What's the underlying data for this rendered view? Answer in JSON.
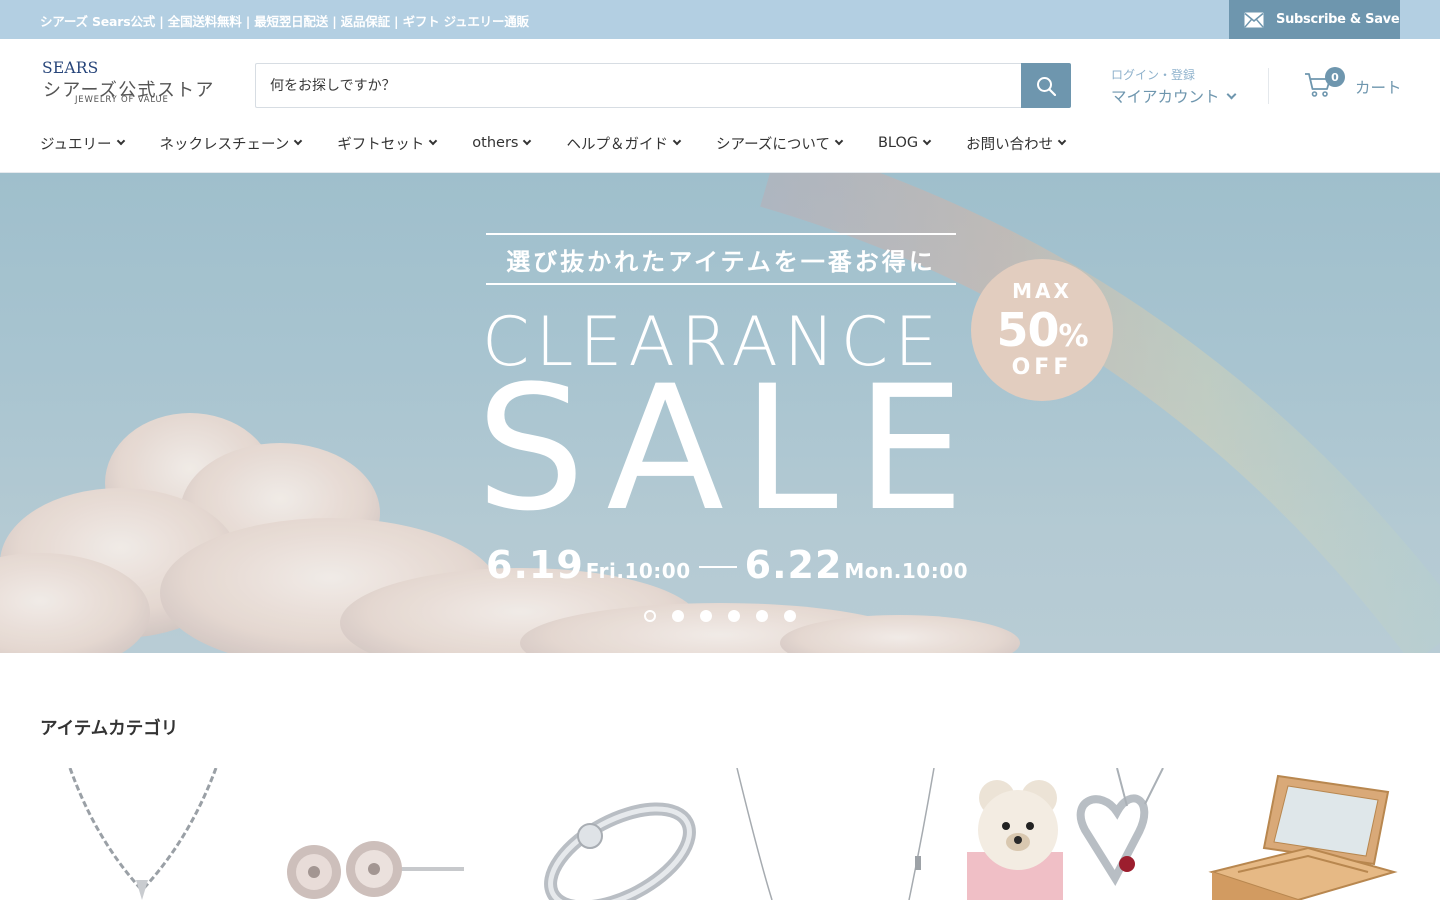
{
  "announcement": {
    "text": "シアーズ Sears公式 | 全国送料無料 | 最短翌日配送 | 返品保証 | ギフト ジュエリー通販",
    "subscribe_label": "Subscribe & Save",
    "bg_color": "#b3cfe2",
    "button_color": "#6e96ae"
  },
  "header": {
    "logo": {
      "brand": "SEARS",
      "name_jp": "シアーズ公式ストア",
      "tagline": "JEWELRY OF VALUE"
    },
    "search": {
      "placeholder": "何をお探しですか？",
      "value": "",
      "icon": "search-icon"
    },
    "account": {
      "login_label": "ログイン・登録",
      "account_label": "マイアカウント"
    },
    "cart": {
      "count": "0",
      "label": "カート",
      "icon": "cart-icon"
    },
    "accent_color": "#6e96ae"
  },
  "nav": {
    "items": [
      {
        "label": "ジュエリー"
      },
      {
        "label": "ネックレスチェーン"
      },
      {
        "label": "ギフトセット"
      },
      {
        "label": "others"
      },
      {
        "label": "ヘルプ＆ガイド"
      },
      {
        "label": "シアーズについて"
      },
      {
        "label": "BLOG"
      },
      {
        "label": "お問い合わせ"
      }
    ]
  },
  "hero": {
    "tagline": "選び抜かれたアイテムを一番お得に",
    "clearance": "CLEARANCE",
    "sale": "SALE",
    "start_date": "6.19",
    "start_time": "Fri.10:00",
    "end_date": "6.22",
    "end_time": "Mon.10:00",
    "badge": {
      "max": "MAX",
      "percent": "50",
      "percent_sign": "%",
      "off": "OFF"
    },
    "slide_count": 6,
    "active_slide": 1
  },
  "categories": {
    "title": "アイテムカテゴリ",
    "items": [
      {
        "icon": "necklace-image"
      },
      {
        "icon": "earrings-image"
      },
      {
        "icon": "ring-image"
      },
      {
        "icon": "chain-image"
      },
      {
        "icon": "gift-set-image"
      },
      {
        "icon": "jewelry-box-image"
      }
    ]
  }
}
